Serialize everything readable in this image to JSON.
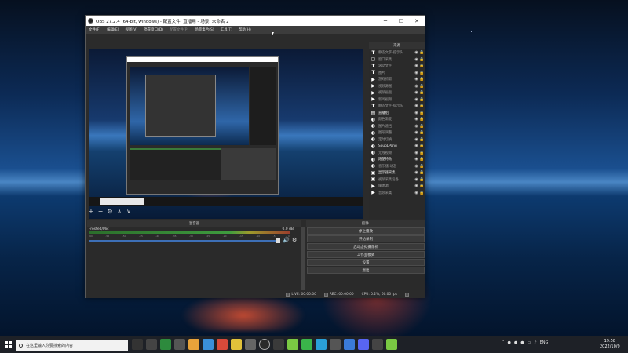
{
  "window": {
    "title": "OBS 27.2.4 (64-bit, windows) - 配置文件: 直播用 - 场景: 未命名 2",
    "controls": [
      "─",
      "☐",
      "✕"
    ]
  },
  "menu": [
    "文件(F)",
    "编辑(E)",
    "视图(V)",
    "停靠窗口(D)",
    "配置文件(P)",
    "场景集合(S)",
    "工具(T)",
    "帮助(H)"
  ],
  "sources": {
    "header": "来源",
    "items": [
      {
        "icon": "T",
        "name": "静态文字-提示头"
      },
      {
        "icon": "▢",
        "name": "窗口采集"
      },
      {
        "icon": "T",
        "name": "滚动文字"
      },
      {
        "icon": "T",
        "name": "图片"
      },
      {
        "icon": "▶",
        "name": "游戏抓取"
      },
      {
        "icon": "▶",
        "name": "视频源图"
      },
      {
        "icon": "▶",
        "name": "视频画面"
      },
      {
        "icon": "▶",
        "name": "新闻视频"
      },
      {
        "icon": "T",
        "name": "静态文字-提示头"
      },
      {
        "icon": "▤",
        "name": "直播组",
        "bright": true
      },
      {
        "icon": "◐",
        "name": "颜色渐变"
      },
      {
        "icon": "◐",
        "name": "图片遮挡"
      },
      {
        "icon": "◐",
        "name": "图形调整"
      },
      {
        "icon": "◐",
        "name": "定时切换"
      },
      {
        "icon": "◐",
        "name": "SoupLPong",
        "bright": true
      },
      {
        "icon": "◐",
        "name": "无线视频"
      },
      {
        "icon": "◐",
        "name": "跑酷特效",
        "bright": true
      },
      {
        "icon": "◐",
        "name": "音乐播-动态"
      },
      {
        "icon": "▣",
        "name": "显示器采集",
        "bright": true
      },
      {
        "icon": "▣",
        "name": "视频采集设备"
      },
      {
        "icon": "▶",
        "name": "媒体源"
      },
      {
        "icon": "▶",
        "name": "音频采集"
      }
    ],
    "tools": [
      "+",
      "−",
      "⚙",
      "∧",
      "∨"
    ]
  },
  "mixer": {
    "header": "混音器",
    "track": "Frosted/Mic",
    "db": "0.0 dB",
    "ticks": [
      "-60",
      "-55",
      "-50",
      "-45",
      "-40",
      "-35",
      "-30",
      "-25",
      "-20",
      "-15",
      "-10",
      "-5",
      "0"
    ],
    "volume_level": 0.95
  },
  "controls": {
    "header": "控件",
    "buttons": [
      "停止播放",
      "开始录制",
      "启动虚拟摄像机",
      "工作室模式",
      "设置",
      "退出"
    ]
  },
  "status": {
    "live": "LIVE: 00:00:00",
    "rec": "REC: 00:00:00",
    "cpu": "CPU: 0.2%, 60.00 fps"
  },
  "taskbar": {
    "search_placeholder": "在这里输入你要搜索的内容",
    "lang": "ENG",
    "time": "19:58",
    "date": "2022/10/9"
  },
  "colors": {
    "obs_bg": "#2b2b2b",
    "accent_volume": "#3d6fb6"
  }
}
